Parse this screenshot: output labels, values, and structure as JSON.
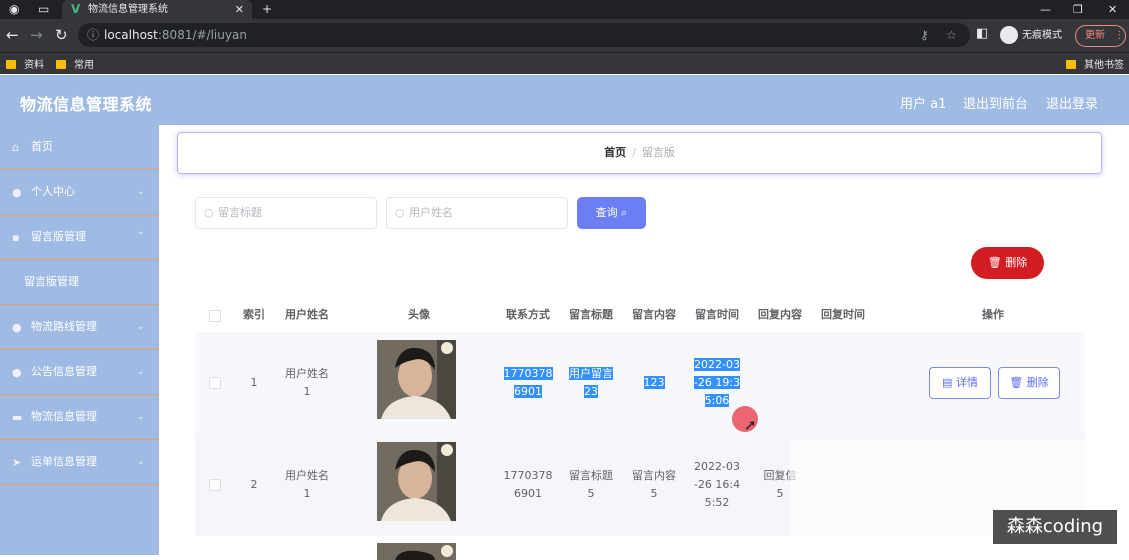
{
  "browser": {
    "tab_title": "物流信息管理系统",
    "url_host": "localhost",
    "url_path": ":8081/#/liuyan",
    "incognito_label": "无痕模式",
    "update_label": "更新",
    "bookmarks": [
      "资料",
      "常用"
    ],
    "other_bookmarks": "其他书签"
  },
  "header": {
    "title": "物流信息管理系统",
    "user": "用户 a1",
    "back_front": "退出到前台",
    "logout": "退出登录"
  },
  "sidebar": {
    "items": [
      {
        "label": "首页",
        "icon": "home-icon"
      },
      {
        "label": "个人中心",
        "icon": "user-icon"
      },
      {
        "label": "留言版管理",
        "icon": "message-icon"
      },
      {
        "label": "留言版管理",
        "icon": ""
      },
      {
        "label": "物流路线管理",
        "icon": "user-icon"
      },
      {
        "label": "公告信息管理",
        "icon": "user-icon"
      },
      {
        "label": "物流信息管理",
        "icon": "book-icon"
      },
      {
        "label": "运单信息管理",
        "icon": "send-icon"
      }
    ]
  },
  "breadcrumb": {
    "home": "首页",
    "sep": "/",
    "current": "留言版"
  },
  "search": {
    "title_placeholder": "留言标题",
    "name_placeholder": "用户姓名",
    "query_label": "查询"
  },
  "actions": {
    "delete_label": "删除"
  },
  "table": {
    "headers": [
      "索引",
      "用户姓名",
      "头像",
      "联系方式",
      "留言标题",
      "留言内容",
      "留言时间",
      "回复内容",
      "回复时间",
      "操作"
    ],
    "rows": [
      {
        "index": "1",
        "name_a": "用户姓名",
        "name_b": "1",
        "phone_a": "1770378",
        "phone_b": "6901",
        "title_a": "用户留言",
        "title_b": "23",
        "content": "123",
        "time_a": "2022-03",
        "time_b": "-26 19:3",
        "time_c": "5:06",
        "reply_a": "",
        "reply_b": "",
        "detail": "详情",
        "delete": "删除"
      },
      {
        "index": "2",
        "name_a": "用户姓名",
        "name_b": "1",
        "phone_a": "1770378",
        "phone_b": "6901",
        "title_a": "留言标题",
        "title_b": "5",
        "content_a": "留言内容",
        "content_b": "5",
        "time_a": "2022-03",
        "time_b": "-26 16:4",
        "time_c": "5:52",
        "reply_a": "回复信",
        "reply_b": "5"
      }
    ]
  },
  "watermark": "森森coding"
}
